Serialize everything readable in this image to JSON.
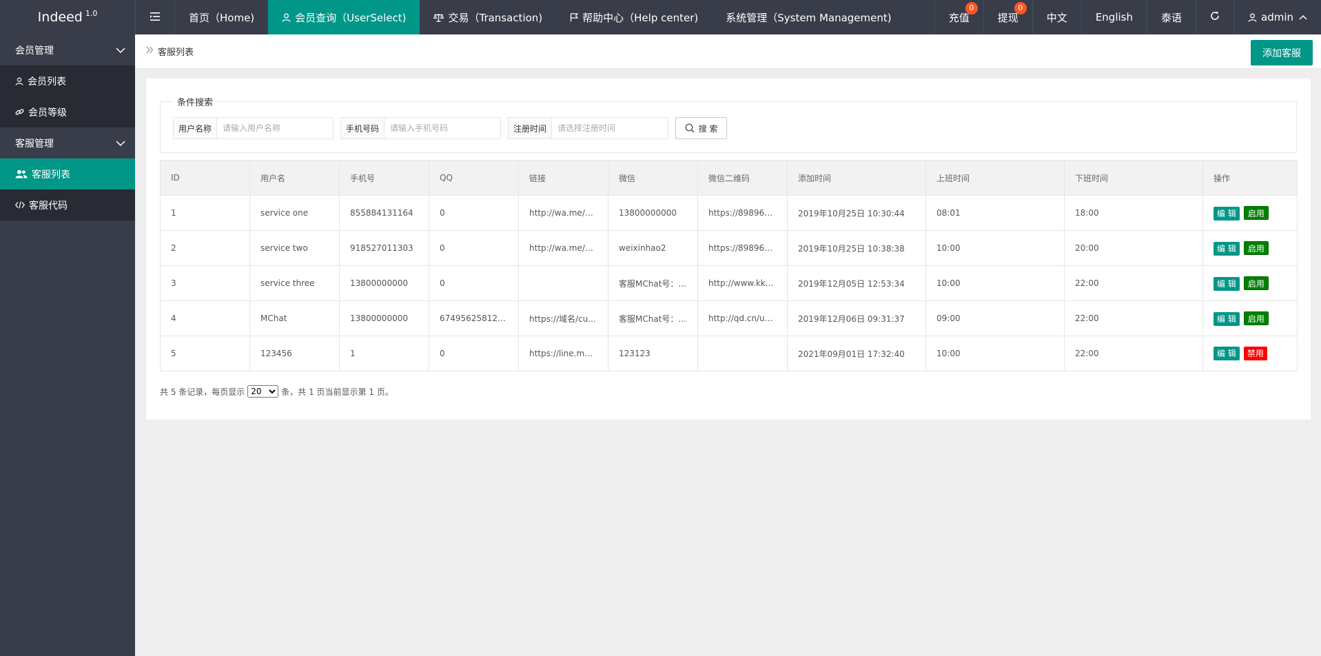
{
  "app": {
    "logo": "Indeed",
    "version": "1.0"
  },
  "topnav": [
    {
      "label": "首页（Home)",
      "icon": ""
    },
    {
      "label": "会员查询（UserSelect)",
      "icon": "user-icon",
      "active": true
    },
    {
      "label": "交易（Transaction)",
      "icon": "scale-icon"
    },
    {
      "label": "帮助中心（Help center)",
      "icon": "flag-icon"
    },
    {
      "label": "系统管理（System Management)",
      "icon": ""
    }
  ],
  "topright": {
    "recharge": {
      "label": "充值",
      "badge": "0"
    },
    "withdraw": {
      "label": "提现",
      "badge": "0"
    },
    "lang_cn": "中文",
    "lang_en": "English",
    "lang_th": "泰语",
    "user": "admin"
  },
  "sidebar": {
    "groups": [
      {
        "title": "会员管理",
        "items": [
          {
            "label": "会员列表",
            "icon": "user-icon"
          },
          {
            "label": "会员等级",
            "icon": "link-icon"
          }
        ]
      },
      {
        "title": "客服管理",
        "items": [
          {
            "label": "客服列表",
            "icon": "users-icon",
            "active": true
          },
          {
            "label": "客服代码",
            "icon": "code-icon"
          }
        ]
      }
    ]
  },
  "breadcrumb": {
    "title": "客服列表"
  },
  "toolbar": {
    "add_label": "添加客服"
  },
  "search": {
    "legend": "条件搜索",
    "username_label": "用户名称",
    "username_placeholder": "请输入用户名称",
    "phone_label": "手机号码",
    "phone_placeholder": "请输入手机号码",
    "regtime_label": "注册时间",
    "regtime_placeholder": "请选择注册时间",
    "button": "搜 索"
  },
  "table": {
    "headers": [
      "ID",
      "用户名",
      "手机号",
      "QQ",
      "链接",
      "微信",
      "微信二维码",
      "添加时间",
      "上班时间",
      "下班时间",
      "操作"
    ],
    "rows": [
      {
        "id": "1",
        "username": "service one",
        "phone": "855884131164",
        "qq": "0",
        "link": "http://wa.me/8...",
        "wechat": "13800000000",
        "qrcode": "https://898966...",
        "added": "2019年10月25日 10:30:44",
        "start": "08:01",
        "end": "18:00",
        "edit": "编 辑",
        "status": "启用",
        "status_on": true
      },
      {
        "id": "2",
        "username": "service two",
        "phone": "918527011303",
        "qq": "0",
        "link": "http://wa.me/9...",
        "wechat": "weixinhao2",
        "qrcode": "https://898966...",
        "added": "2019年10月25日 10:38:38",
        "start": "10:00",
        "end": "20:00",
        "edit": "编 辑",
        "status": "启用",
        "status_on": true
      },
      {
        "id": "3",
        "username": "service three",
        "phone": "13800000000",
        "qq": "0",
        "link": "",
        "wechat": "客服MChat号：...",
        "qrcode": "http://www.kku...",
        "added": "2019年12月05日 12:53:34",
        "start": "10:00",
        "end": "22:00",
        "edit": "编 辑",
        "status": "启用",
        "status_on": true
      },
      {
        "id": "4",
        "username": "MChat",
        "phone": "13800000000",
        "qq": "6749562581233",
        "link": "https://域名/cu...",
        "wechat": "客服MChat号：...",
        "qrcode": "http://qd.cn/up...",
        "added": "2019年12月06日 09:31:37",
        "start": "09:00",
        "end": "22:00",
        "edit": "编 辑",
        "status": "启用",
        "status_on": true
      },
      {
        "id": "5",
        "username": "123456",
        "phone": "1",
        "qq": "0",
        "link": "https://line.me/...",
        "wechat": "123123",
        "qrcode": "",
        "added": "2021年09月01日 17:32:40",
        "start": "10:00",
        "end": "22:00",
        "edit": "编 辑",
        "status": "禁用",
        "status_on": false
      }
    ]
  },
  "pager": {
    "prefix": "共 5 条记录，每页显示",
    "page_size": "20",
    "suffix": "条，共 1 页当前显示第 1 页。"
  },
  "colors": {
    "topbar": "#393d49",
    "accent": "#009688",
    "enabled": "#008000",
    "disabled": "#ff0000",
    "badge": "#ff5722"
  }
}
